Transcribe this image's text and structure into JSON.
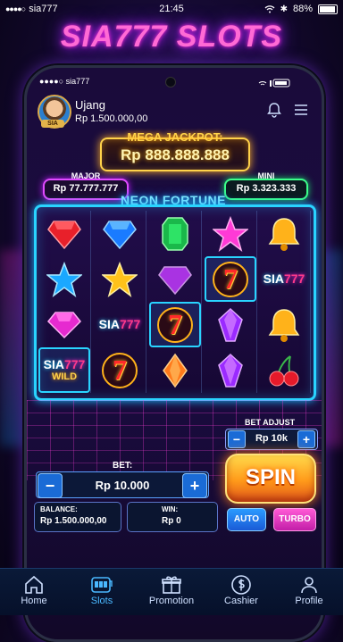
{
  "statusbar": {
    "carrier_dots": "●●●●○",
    "carrier": "sia777",
    "time": "21:45",
    "battery": "88%"
  },
  "title": "SIA777 SLOTS",
  "phone_status": {
    "carrier": "●●●●○ sia777"
  },
  "user": {
    "name": "Ujang",
    "balance": "Rp 1.500.000,00",
    "badge": "SIA"
  },
  "jackpot": {
    "label": "MEGA JACKPOT:",
    "value": "Rp 888.888.888"
  },
  "major": {
    "label": "MAJOR",
    "value": "Rp 77.777.777"
  },
  "mini": {
    "label": "MINI",
    "value": "Rp 3.323.333"
  },
  "game_name": "NEON FORTUNE",
  "reels": [
    [
      "ruby",
      "star-blue",
      "gem-pink",
      "sia777-wild"
    ],
    [
      "diamond-blue",
      "star-gold",
      "sia777",
      "seven"
    ],
    [
      "emerald",
      "diamond-purple",
      "seven-hl",
      "diamond-orange"
    ],
    [
      "star-pink",
      "seven-hl",
      "gem-purple",
      "gem-purple"
    ],
    [
      "bell",
      "sia777",
      "bell",
      "cherry"
    ]
  ],
  "symbol_text": {
    "sia": "SIA",
    "num": "777",
    "wild": "WILD",
    "seven": "7"
  },
  "controls": {
    "bet_adjust_label": "BET ADJUST",
    "bet_adjust_value": "Rp 10k",
    "bet_label": "BET:",
    "bet_value": "Rp 10.000",
    "spin": "SPIN",
    "balance_label": "BALANCE:",
    "balance_value": "Rp 1.500.000,00",
    "win_label": "WIN:",
    "win_value": "Rp 0",
    "auto": "AUTO",
    "turbo": "TURBO",
    "minus": "−",
    "plus": "+"
  },
  "nav": [
    {
      "label": "Home",
      "icon": "home-icon"
    },
    {
      "label": "Slots",
      "icon": "slot-machine-icon",
      "active": true
    },
    {
      "label": "Promotion",
      "icon": "gift-icon"
    },
    {
      "label": "Cashier",
      "icon": "dollar-icon"
    },
    {
      "label": "Profile",
      "icon": "user-icon"
    }
  ],
  "colors": {
    "neon_pink": "#ff2bd6",
    "neon_blue": "#29d4ff",
    "gold": "#ffd24a",
    "green": "#3cff8a"
  }
}
